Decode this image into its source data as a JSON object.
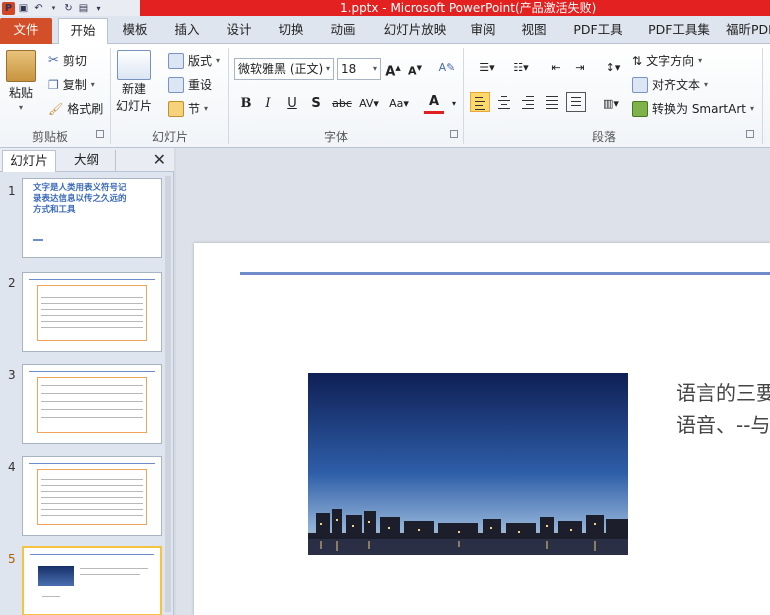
{
  "window": {
    "title": "1.pptx - Microsoft PowerPoint(产品激活失败)"
  },
  "tabs": [
    {
      "label": "文件"
    },
    {
      "label": "开始"
    },
    {
      "label": "模板"
    },
    {
      "label": "插入"
    },
    {
      "label": "设计"
    },
    {
      "label": "切换"
    },
    {
      "label": "动画"
    },
    {
      "label": "幻灯片放映"
    },
    {
      "label": "审阅"
    },
    {
      "label": "视图"
    },
    {
      "label": "PDF工具"
    },
    {
      "label": "PDF工具集"
    },
    {
      "label": "福昕PDF"
    }
  ],
  "ribbon": {
    "clipboard": {
      "paste": "粘贴",
      "cut": "剪切",
      "copy": "复制",
      "format_painter": "格式刷",
      "group": "剪贴板"
    },
    "slides": {
      "new_slide_1": "新建",
      "new_slide_2": "幻灯片",
      "layout": "版式",
      "reset": "重设",
      "section": "节",
      "group": "幻灯片"
    },
    "font": {
      "name": "微软雅黑 (正文)",
      "size": "18",
      "group": "字体"
    },
    "paragraph": {
      "text_direction": "文字方向",
      "align_text": "对齐文本",
      "smartart": "转换为 SmartArt",
      "group": "段落"
    }
  },
  "pane": {
    "tab_slides": "幻灯片",
    "tab_outline": "大纲",
    "close": "✕"
  },
  "thumbnails": [
    {
      "num": "1",
      "title": "文字是人类用表义符号记录表达信息以传之久远的方式和工具"
    },
    {
      "num": "2"
    },
    {
      "num": "3"
    },
    {
      "num": "4"
    },
    {
      "num": "5"
    }
  ],
  "slide": {
    "line1": "语言的三要",
    "line2": "语音、--与"
  }
}
